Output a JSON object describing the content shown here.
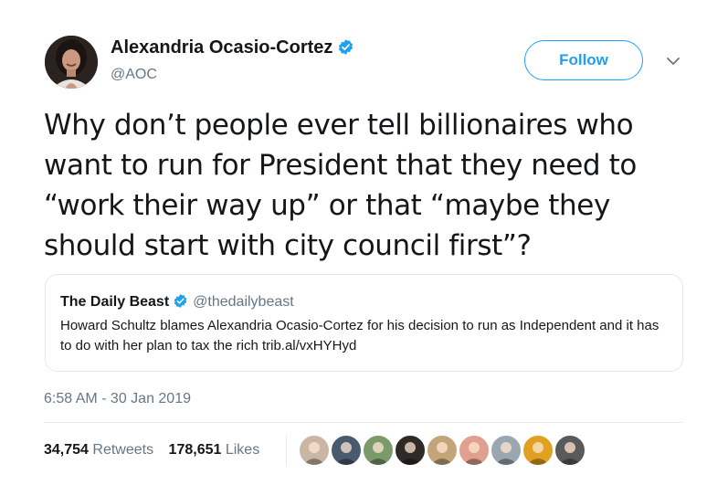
{
  "author": {
    "name": "Alexandria Ocasio-Cortez",
    "handle": "@AOC",
    "verified": true,
    "avatar_icon": "profile-photo"
  },
  "actions": {
    "follow_label": "Follow",
    "menu_icon": "chevron-down-icon"
  },
  "tweet": {
    "text": "Why don’t people ever tell billionaires who want to run for President that they need to “work their way up” or that “maybe they should start with city council first”?"
  },
  "quoted_tweet": {
    "author_name": "The Daily Beast",
    "verified": true,
    "handle": "@thedailybeast",
    "text": "Howard Schultz blames Alexandria Ocasio-Cortez for his decision to run as Independent and it has to do with her plan to tax the rich trib.al/vxHYHyd"
  },
  "timestamp": "6:58 AM - 30 Jan 2019",
  "stats": {
    "retweets_count": "34,754",
    "retweets_label": "Retweets",
    "likes_count": "178,651",
    "likes_label": "Likes"
  },
  "likers": [
    {
      "color": "#c9b6a4"
    },
    {
      "color": "#4a5a6e"
    },
    {
      "color": "#7a9a6a"
    },
    {
      "color": "#2d2a28"
    },
    {
      "color": "#c4a57a"
    },
    {
      "color": "#e0a090"
    },
    {
      "color": "#9aa6b0"
    },
    {
      "color": "#e0a020"
    },
    {
      "color": "#5a5a5a"
    }
  ],
  "colors": {
    "accent": "#1da1f2",
    "secondary_text": "#657786",
    "primary_text": "#14171a",
    "border": "#e1e8ed"
  }
}
